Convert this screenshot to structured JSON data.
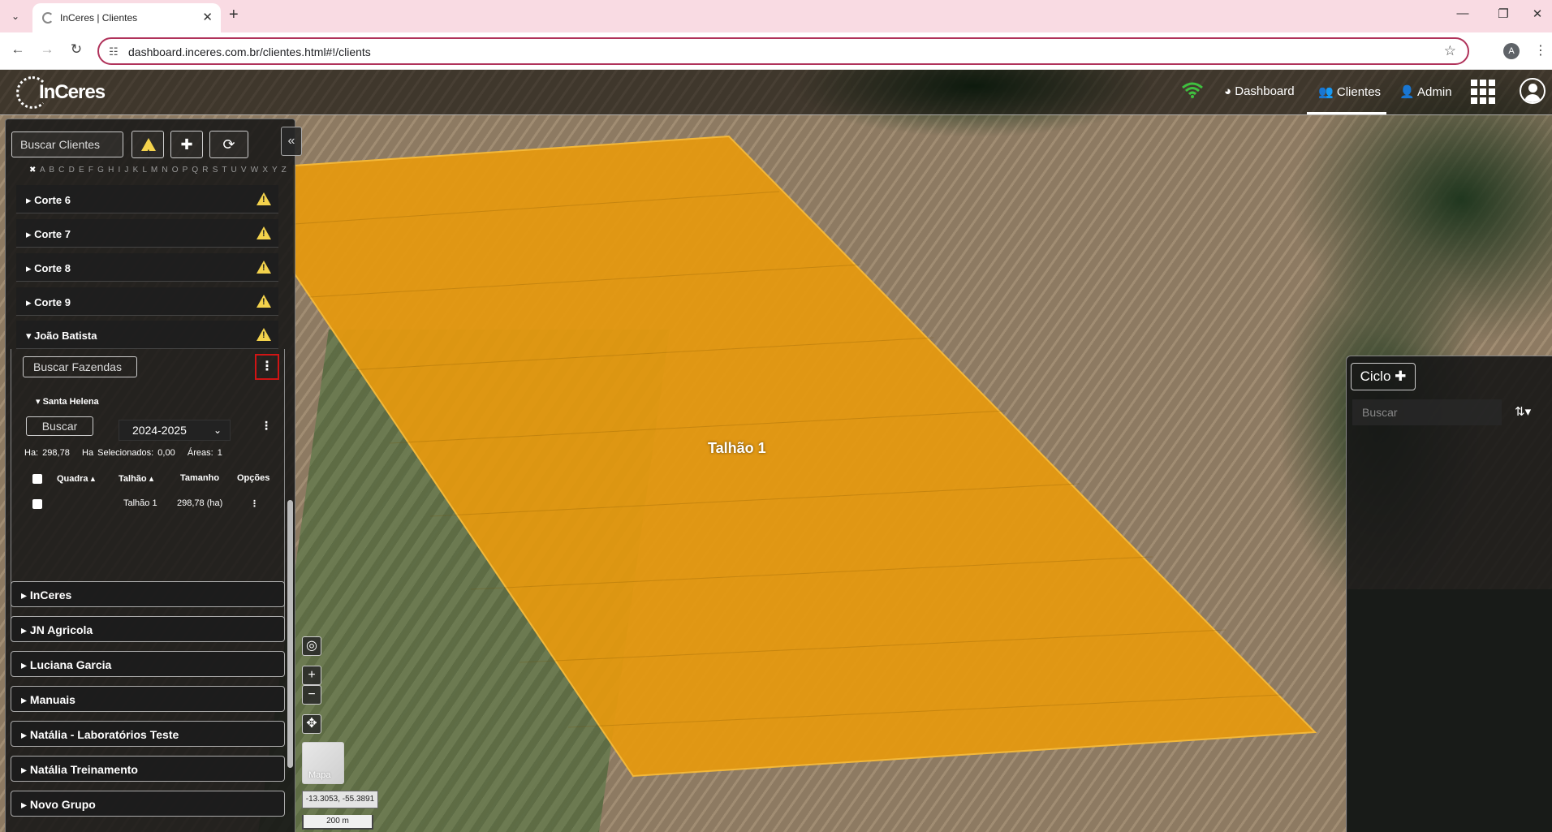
{
  "browser": {
    "tab_title": "InCeres | Clientes",
    "url": "dashboard.inceres.com.br/clientes.html#!/clients",
    "profile_initial": "A"
  },
  "header": {
    "logo_text": "InCeres",
    "nav": {
      "dashboard": "Dashboard",
      "clientes": "Clientes",
      "admin": "Admin"
    }
  },
  "left_panel": {
    "search_clients_placeholder": "Buscar Clientes",
    "alphabet": "A B C D E F G H I J K L M N O P Q R S T U V W X Y Z",
    "clear_filter": "✖",
    "corte_items": [
      "Corte 6",
      "Corte 7",
      "Corte 8",
      "Corte 9"
    ],
    "expanded_client": "João Batista",
    "search_farms_placeholder": "Buscar Fazendas",
    "farm_name": "Santa Helena",
    "buscar_label": "Buscar",
    "season": "2024-2025",
    "stats": {
      "ha": "Ha: 298,78",
      "ha_selected": "Ha Selecionados: 0,00",
      "areas": "Áreas: 1"
    },
    "table": {
      "headers": [
        "Quadra",
        "Talhão",
        "Tamanho",
        "Opções"
      ],
      "rows": [
        {
          "quadra": "",
          "talhao": "Talhão 1",
          "tamanho": "298,78 (ha)"
        }
      ]
    },
    "groups": [
      "InCeres",
      "JN Agricola",
      "Luciana Garcia",
      "Manuais",
      "Natália - Laboratórios Teste",
      "Natália Treinamento",
      "Novo Grupo"
    ]
  },
  "map": {
    "plot_label": "Talhão 1",
    "plot_color": "#e6990e",
    "layer_label": "Mapa",
    "coords": "-13.3053, -55.3891",
    "scale": "200 m"
  },
  "right_panel": {
    "ciclo_label": "Ciclo",
    "search_placeholder": "Buscar"
  }
}
